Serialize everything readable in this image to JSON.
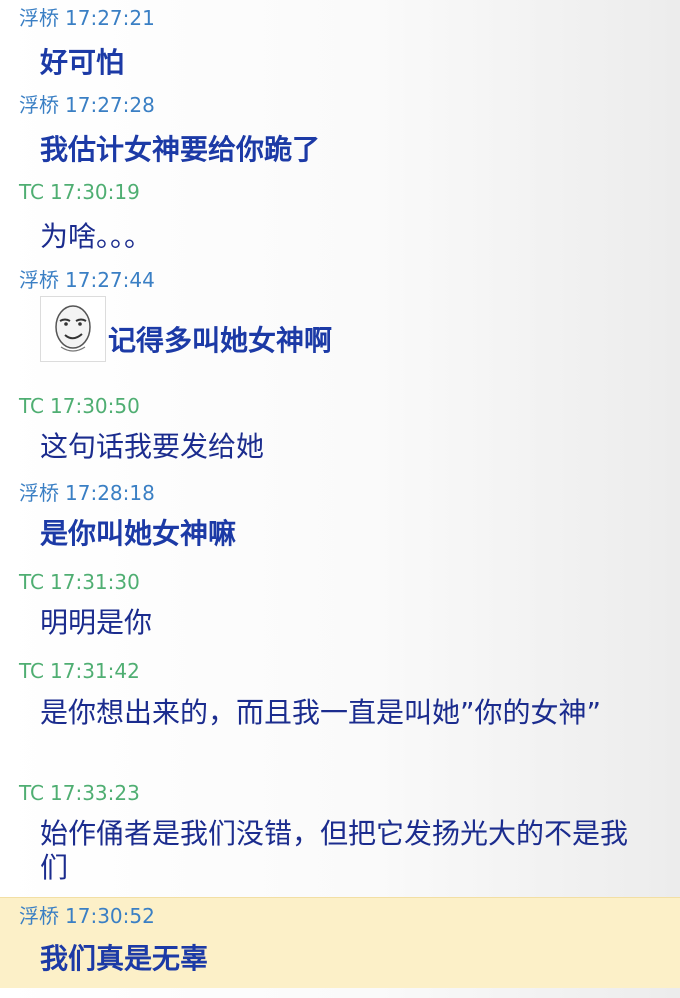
{
  "messages": [
    {
      "sender": "浮桥",
      "time": "17:27:21",
      "text": "好可怕",
      "bold": true
    },
    {
      "sender": "浮桥",
      "time": "17:27:28",
      "text": "我估计女神要给你跪了",
      "bold": true
    },
    {
      "sender": "TC",
      "time": "17:30:19",
      "text": "为啥。。。",
      "bold": false
    },
    {
      "sender": "浮桥",
      "time": "17:27:44",
      "text": "记得多叫她女神啊",
      "bold": true,
      "emoji": "smirk-face-icon"
    },
    {
      "sender": "TC",
      "time": "17:30:50",
      "text": "这句话我要发给她",
      "bold": false
    },
    {
      "sender": "浮桥",
      "time": "17:28:18",
      "text": "是你叫她女神嘛",
      "bold": true
    },
    {
      "sender": "TC",
      "time": "17:31:30",
      "text": "明明是你",
      "bold": false
    },
    {
      "sender": "TC",
      "time": "17:31:42",
      "text": "是你想出来的，而且我一直是叫她”你的女神”",
      "bold": false
    },
    {
      "sender": "TC",
      "time": "17:33:23",
      "text": "始作俑者是我们没错，但把它发扬光大的不是我们",
      "bold": false
    },
    {
      "sender": "浮桥",
      "time": "17:30:52",
      "text": "我们真是无辜",
      "bold": true,
      "highlighted": true
    }
  ],
  "colors": {
    "sender_fuqiao": "#3a7fc4",
    "sender_tc": "#4fae72",
    "message_text": "#1b2c8e",
    "highlight_bg": "#fcf0c8"
  }
}
